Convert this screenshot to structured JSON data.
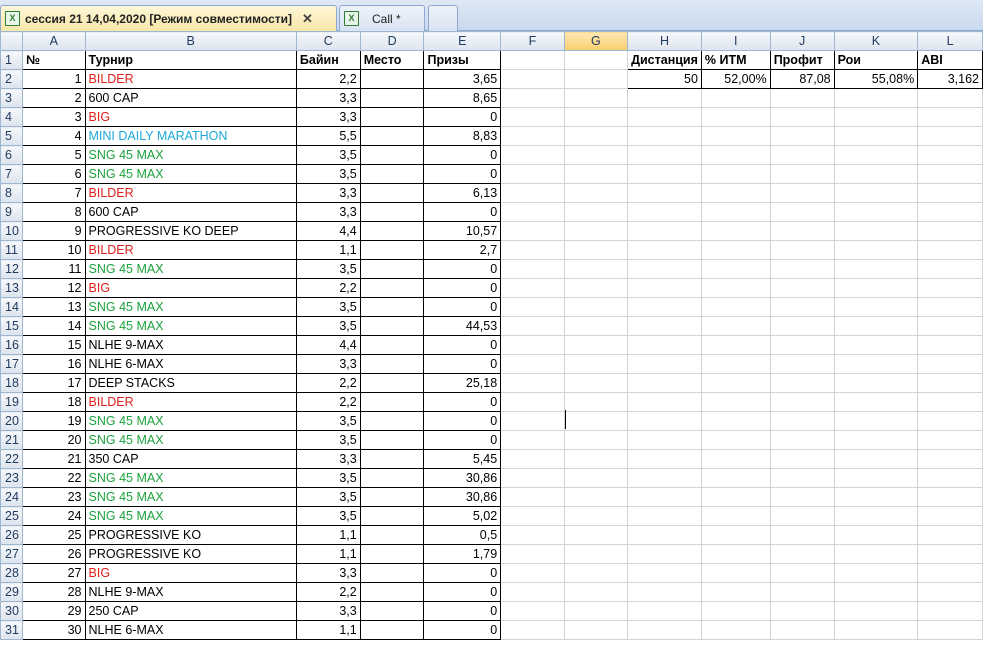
{
  "tabs": [
    {
      "label": "сессия 21 14,04,2020  [Режим совместимости]",
      "icon": "excel-file-icon",
      "active": true,
      "close": "✕"
    },
    {
      "label": "Call *",
      "icon": "excel-file-icon",
      "active": false
    },
    {
      "label": "",
      "icon": "",
      "active": false
    }
  ],
  "columns": [
    "A",
    "B",
    "C",
    "D",
    "E",
    "F",
    "G",
    "H",
    "I",
    "J",
    "K",
    "L"
  ],
  "selected_column": "G",
  "header_row": [
    "№",
    "Турнир",
    "Байин",
    "Место",
    "Призы",
    "",
    "",
    "Дистанция",
    "% ИТМ",
    "Профит",
    "Рои",
    "ABI"
  ],
  "stats_row": [
    "",
    "",
    "",
    "",
    "",
    "",
    "",
    "50",
    "52,00%",
    "87,08",
    "55,08%",
    "3,162"
  ],
  "colors": {
    "red": "#e0201b",
    "green": "#1ca23c",
    "blue": "#1ea8d8",
    "black": "#000000"
  },
  "rows": [
    {
      "n": "1",
      "name": "BILDER",
      "color": "red",
      "buyin": "2,2",
      "place": "",
      "prize": "3,65"
    },
    {
      "n": "2",
      "name": "600 CAP",
      "color": "black",
      "buyin": "3,3",
      "place": "",
      "prize": "8,65"
    },
    {
      "n": "3",
      "name": "BIG",
      "color": "red",
      "buyin": "3,3",
      "place": "",
      "prize": "0"
    },
    {
      "n": "4",
      "name": "MINI DAILY MARATHON",
      "color": "blue",
      "buyin": "5,5",
      "place": "",
      "prize": "8,83"
    },
    {
      "n": "5",
      "name": "SNG 45 MAX",
      "color": "green",
      "buyin": "3,5",
      "place": "",
      "prize": "0"
    },
    {
      "n": "6",
      "name": "SNG 45 MAX",
      "color": "green",
      "buyin": "3,5",
      "place": "",
      "prize": "0"
    },
    {
      "n": "7",
      "name": "BILDER",
      "color": "red",
      "buyin": "3,3",
      "place": "",
      "prize": "6,13"
    },
    {
      "n": "8",
      "name": "600 CAP",
      "color": "black",
      "buyin": "3,3",
      "place": "",
      "prize": "0"
    },
    {
      "n": "9",
      "name": "PROGRESSIVE KO DEEP",
      "color": "black",
      "buyin": "4,4",
      "place": "",
      "prize": "10,57"
    },
    {
      "n": "10",
      "name": "BILDER",
      "color": "red",
      "buyin": "1,1",
      "place": "",
      "prize": "2,7"
    },
    {
      "n": "11",
      "name": "SNG 45 MAX",
      "color": "green",
      "buyin": "3,5",
      "place": "",
      "prize": "0"
    },
    {
      "n": "12",
      "name": "BIG",
      "color": "red",
      "buyin": "2,2",
      "place": "",
      "prize": "0"
    },
    {
      "n": "13",
      "name": "SNG 45 MAX",
      "color": "green",
      "buyin": "3,5",
      "place": "",
      "prize": "0"
    },
    {
      "n": "14",
      "name": "SNG 45 MAX",
      "color": "green",
      "buyin": "3,5",
      "place": "",
      "prize": "44,53"
    },
    {
      "n": "15",
      "name": "NLHE 9-MAX",
      "color": "black",
      "buyin": "4,4",
      "place": "",
      "prize": "0"
    },
    {
      "n": "16",
      "name": "NLHE 6-MAX",
      "color": "black",
      "buyin": "3,3",
      "place": "",
      "prize": "0"
    },
    {
      "n": "17",
      "name": "DEEP STACKS",
      "color": "black",
      "buyin": "2,2",
      "place": "",
      "prize": "25,18"
    },
    {
      "n": "18",
      "name": "BILDER",
      "color": "red",
      "buyin": "2,2",
      "place": "",
      "prize": "0"
    },
    {
      "n": "19",
      "name": "SNG 45 MAX",
      "color": "green",
      "buyin": "3,5",
      "place": "",
      "prize": "0"
    },
    {
      "n": "20",
      "name": "SNG 45 MAX",
      "color": "green",
      "buyin": "3,5",
      "place": "",
      "prize": "0"
    },
    {
      "n": "21",
      "name": "350 CAP",
      "color": "black",
      "buyin": "3,3",
      "place": "",
      "prize": "5,45"
    },
    {
      "n": "22",
      "name": "SNG 45 MAX",
      "color": "green",
      "buyin": "3,5",
      "place": "",
      "prize": "30,86"
    },
    {
      "n": "23",
      "name": "SNG 45 MAX",
      "color": "green",
      "buyin": "3,5",
      "place": "",
      "prize": "30,86"
    },
    {
      "n": "24",
      "name": "SNG 45 MAX",
      "color": "green",
      "buyin": "3,5",
      "place": "",
      "prize": "5,02"
    },
    {
      "n": "25",
      "name": "PROGRESSIVE KO",
      "color": "black",
      "buyin": "1,1",
      "place": "",
      "prize": "0,5"
    },
    {
      "n": "26",
      "name": "PROGRESSIVE KO",
      "color": "black",
      "buyin": "1,1",
      "place": "",
      "prize": "1,79"
    },
    {
      "n": "27",
      "name": "BIG",
      "color": "red",
      "buyin": "3,3",
      "place": "",
      "prize": "0"
    },
    {
      "n": "28",
      "name": "NLHE 9-MAX",
      "color": "black",
      "buyin": "2,2",
      "place": "",
      "prize": "0"
    },
    {
      "n": "29",
      "name": "250 CAP",
      "color": "black",
      "buyin": "3,3",
      "place": "",
      "prize": "0"
    },
    {
      "n": "30",
      "name": "NLHE 6-MAX",
      "color": "black",
      "buyin": "1,1",
      "place": "",
      "prize": "0"
    }
  ]
}
